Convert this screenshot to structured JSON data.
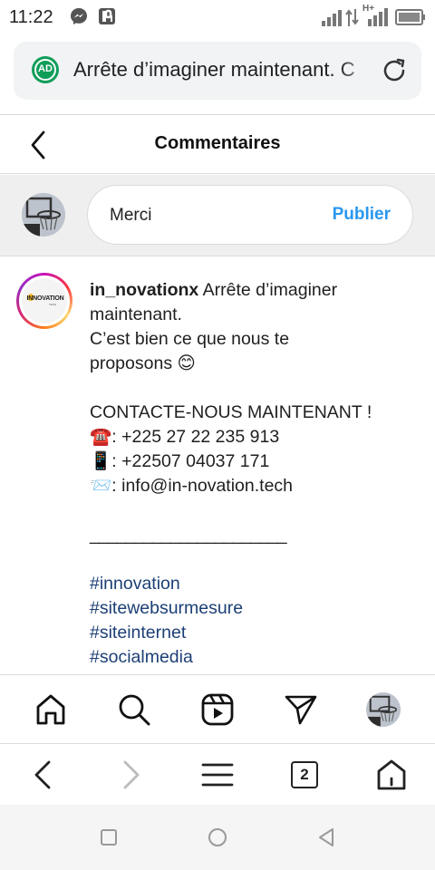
{
  "status_bar": {
    "time": "11:22",
    "network_label": "H+"
  },
  "browser": {
    "ad_badge": "AD",
    "url_text": "Arrête d’imaginer maintenant. C",
    "tab_count": "2"
  },
  "header": {
    "title": "Commentaires"
  },
  "comment_input": {
    "value": "Merci",
    "publish_label": "Publier"
  },
  "post": {
    "logo_text": "INNOVATION",
    "logo_subtext": "TECH",
    "username": "in_novationx",
    "lines": [
      "Arrête d’imaginer",
      "maintenant.",
      "C’est bien ce que nous te",
      "proposons 😊",
      "CONTACTE-NOUS MAINTENANT !",
      "☎️: +225 27 22 235 913",
      "📱: +22507 04037 171",
      "📨: info@in-novation.tech",
      "______________________",
      "#innovation",
      "#sitewebsurmesure",
      "#siteinternet",
      "#socialmedia"
    ]
  },
  "colors": {
    "accent_blue": "#2a97ef",
    "hashtag_blue": "#1c3f75",
    "ad_green": "#0f9d58",
    "bg_gray": "#efefef"
  },
  "icons": {
    "status": [
      "messenger-icon",
      "pi-icon",
      "signal-icon",
      "data-arrows-icon",
      "battery-icon"
    ],
    "bottom_nav": [
      "home-icon",
      "search-icon",
      "reels-icon",
      "send-icon",
      "profile-avatar"
    ],
    "browser_toolbar": [
      "back-icon",
      "forward-icon",
      "menu-icon",
      "tabs-icon",
      "home-icon"
    ],
    "android_nav": [
      "recents-icon",
      "home-circle-icon",
      "back-triangle-icon"
    ]
  }
}
